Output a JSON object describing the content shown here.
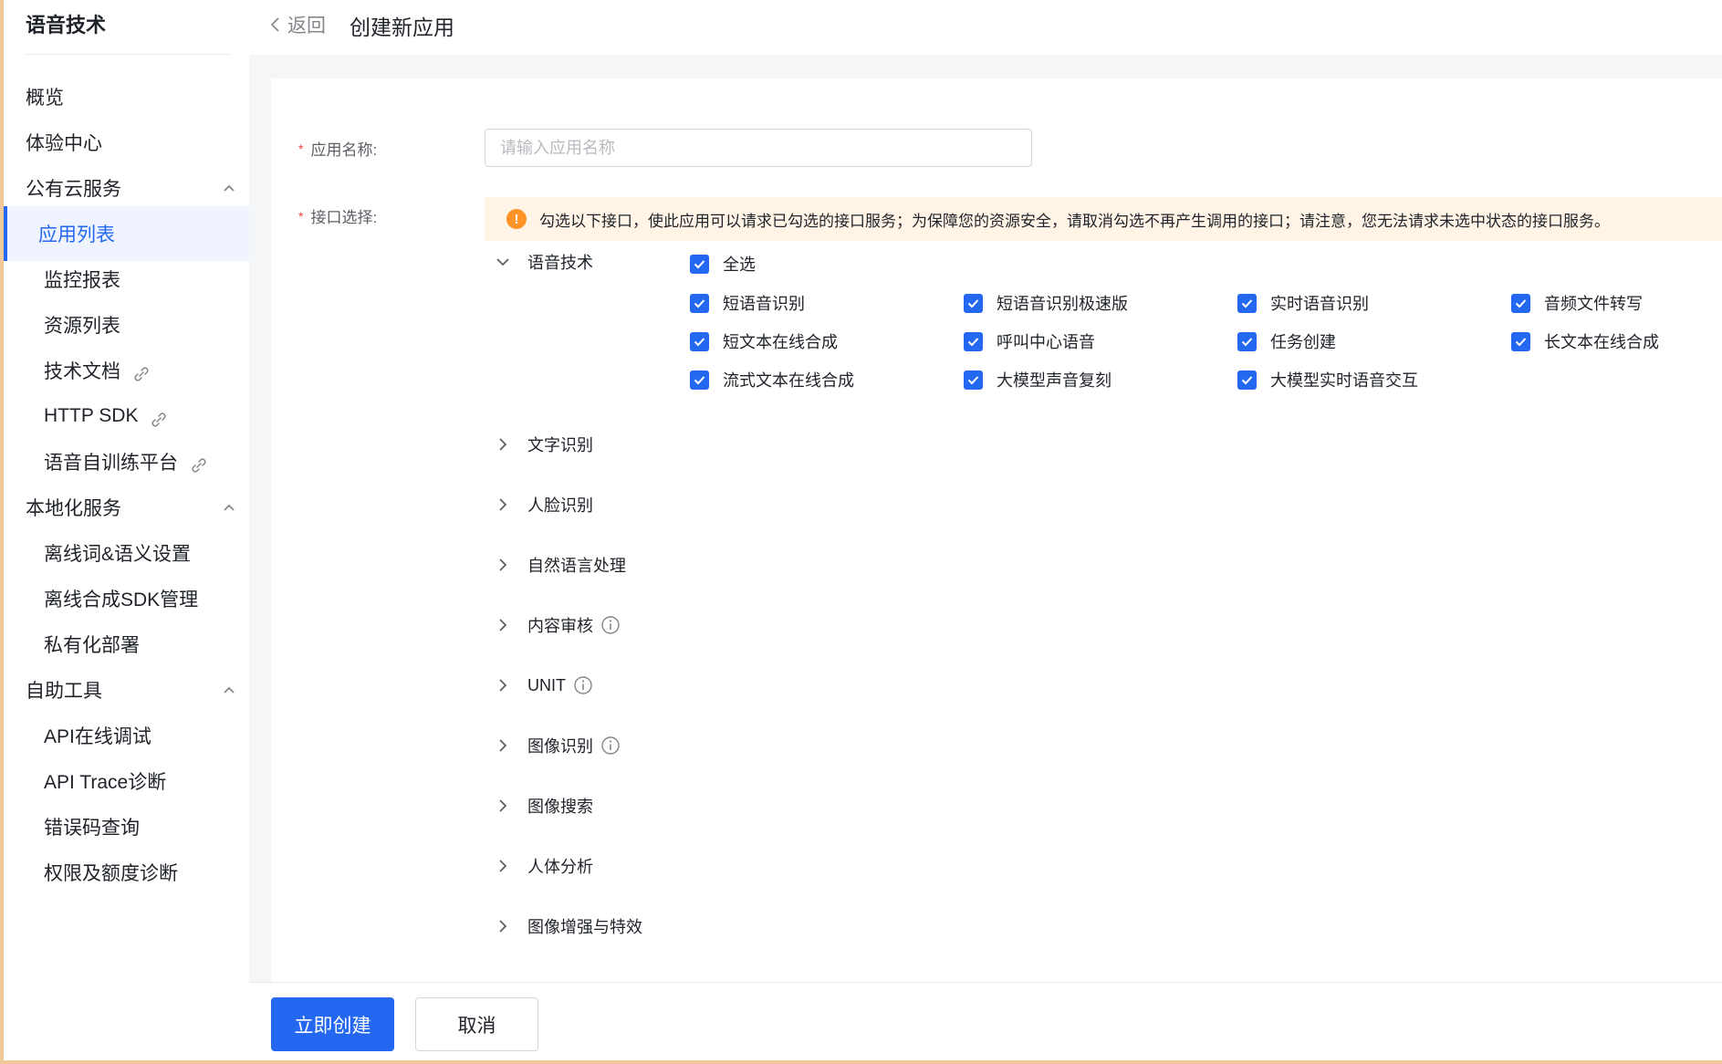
{
  "sidebar": {
    "title": "语音技术",
    "items": [
      {
        "label": "概览"
      },
      {
        "label": "体验中心"
      },
      {
        "label": "公有云服务"
      },
      {
        "label": "应用列表"
      },
      {
        "label": "监控报表"
      },
      {
        "label": "资源列表"
      },
      {
        "label": "技术文档"
      },
      {
        "label": "HTTP SDK"
      },
      {
        "label": "语音自训练平台"
      },
      {
        "label": "本地化服务"
      },
      {
        "label": "离线词&语义设置"
      },
      {
        "label": "离线合成SDK管理"
      },
      {
        "label": "私有化部署"
      },
      {
        "label": "自助工具"
      },
      {
        "label": "API在线调试"
      },
      {
        "label": "API Trace诊断"
      },
      {
        "label": "错误码查询"
      },
      {
        "label": "权限及额度诊断"
      }
    ]
  },
  "header": {
    "back_label": "返回",
    "page_title": "创建新应用"
  },
  "form": {
    "name_label": "应用名称:",
    "name_placeholder": "请输入应用名称",
    "name_value": "",
    "api_label": "接口选择:",
    "required_mark": "*",
    "notice": "勾选以下接口，使此应用可以请求已勾选的接口服务；为保障您的资源安全，请取消勾选不再产生调用的接口；请注意，您无法请求未选中状态的接口服务。",
    "notice_icon": "!",
    "speech_group": {
      "label": "语音技术",
      "select_all": "全选",
      "apis": [
        "短语音识别",
        "短语音识别极速版",
        "实时语音识别",
        "音频文件转写",
        "短文本在线合成",
        "呼叫中心语音",
        "任务创建",
        "长文本在线合成",
        "流式文本在线合成",
        "大模型声音复刻",
        "大模型实时语音交互"
      ]
    },
    "groups": [
      {
        "label": "文字识别"
      },
      {
        "label": "人脸识别"
      },
      {
        "label": "自然语言处理"
      },
      {
        "label": "内容审核"
      },
      {
        "label": "UNIT"
      },
      {
        "label": "图像识别"
      },
      {
        "label": "图像搜索"
      },
      {
        "label": "人体分析"
      },
      {
        "label": "图像增强与特效"
      }
    ]
  },
  "footer": {
    "create_label": "立即创建",
    "cancel_label": "取消"
  },
  "colors": {
    "primary": "#2468f2",
    "warning": "#ff9326",
    "notice_bg": "#fff4e6",
    "required": "#f33e3e"
  }
}
